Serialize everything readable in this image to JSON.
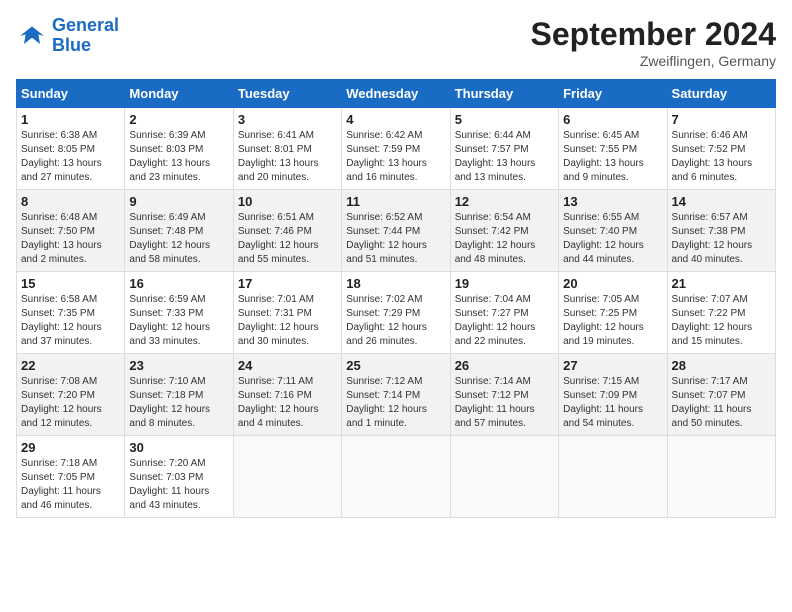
{
  "header": {
    "logo_general": "General",
    "logo_blue": "Blue",
    "month_title": "September 2024",
    "location": "Zweiflingen, Germany"
  },
  "calendar": {
    "weekdays": [
      "Sunday",
      "Monday",
      "Tuesday",
      "Wednesday",
      "Thursday",
      "Friday",
      "Saturday"
    ],
    "rows": [
      [
        {
          "day": "1",
          "info": "Sunrise: 6:38 AM\nSunset: 8:05 PM\nDaylight: 13 hours\nand 27 minutes."
        },
        {
          "day": "2",
          "info": "Sunrise: 6:39 AM\nSunset: 8:03 PM\nDaylight: 13 hours\nand 23 minutes."
        },
        {
          "day": "3",
          "info": "Sunrise: 6:41 AM\nSunset: 8:01 PM\nDaylight: 13 hours\nand 20 minutes."
        },
        {
          "day": "4",
          "info": "Sunrise: 6:42 AM\nSunset: 7:59 PM\nDaylight: 13 hours\nand 16 minutes."
        },
        {
          "day": "5",
          "info": "Sunrise: 6:44 AM\nSunset: 7:57 PM\nDaylight: 13 hours\nand 13 minutes."
        },
        {
          "day": "6",
          "info": "Sunrise: 6:45 AM\nSunset: 7:55 PM\nDaylight: 13 hours\nand 9 minutes."
        },
        {
          "day": "7",
          "info": "Sunrise: 6:46 AM\nSunset: 7:52 PM\nDaylight: 13 hours\nand 6 minutes."
        }
      ],
      [
        {
          "day": "8",
          "info": "Sunrise: 6:48 AM\nSunset: 7:50 PM\nDaylight: 13 hours\nand 2 minutes."
        },
        {
          "day": "9",
          "info": "Sunrise: 6:49 AM\nSunset: 7:48 PM\nDaylight: 12 hours\nand 58 minutes."
        },
        {
          "day": "10",
          "info": "Sunrise: 6:51 AM\nSunset: 7:46 PM\nDaylight: 12 hours\nand 55 minutes."
        },
        {
          "day": "11",
          "info": "Sunrise: 6:52 AM\nSunset: 7:44 PM\nDaylight: 12 hours\nand 51 minutes."
        },
        {
          "day": "12",
          "info": "Sunrise: 6:54 AM\nSunset: 7:42 PM\nDaylight: 12 hours\nand 48 minutes."
        },
        {
          "day": "13",
          "info": "Sunrise: 6:55 AM\nSunset: 7:40 PM\nDaylight: 12 hours\nand 44 minutes."
        },
        {
          "day": "14",
          "info": "Sunrise: 6:57 AM\nSunset: 7:38 PM\nDaylight: 12 hours\nand 40 minutes."
        }
      ],
      [
        {
          "day": "15",
          "info": "Sunrise: 6:58 AM\nSunset: 7:35 PM\nDaylight: 12 hours\nand 37 minutes."
        },
        {
          "day": "16",
          "info": "Sunrise: 6:59 AM\nSunset: 7:33 PM\nDaylight: 12 hours\nand 33 minutes."
        },
        {
          "day": "17",
          "info": "Sunrise: 7:01 AM\nSunset: 7:31 PM\nDaylight: 12 hours\nand 30 minutes."
        },
        {
          "day": "18",
          "info": "Sunrise: 7:02 AM\nSunset: 7:29 PM\nDaylight: 12 hours\nand 26 minutes."
        },
        {
          "day": "19",
          "info": "Sunrise: 7:04 AM\nSunset: 7:27 PM\nDaylight: 12 hours\nand 22 minutes."
        },
        {
          "day": "20",
          "info": "Sunrise: 7:05 AM\nSunset: 7:25 PM\nDaylight: 12 hours\nand 19 minutes."
        },
        {
          "day": "21",
          "info": "Sunrise: 7:07 AM\nSunset: 7:22 PM\nDaylight: 12 hours\nand 15 minutes."
        }
      ],
      [
        {
          "day": "22",
          "info": "Sunrise: 7:08 AM\nSunset: 7:20 PM\nDaylight: 12 hours\nand 12 minutes."
        },
        {
          "day": "23",
          "info": "Sunrise: 7:10 AM\nSunset: 7:18 PM\nDaylight: 12 hours\nand 8 minutes."
        },
        {
          "day": "24",
          "info": "Sunrise: 7:11 AM\nSunset: 7:16 PM\nDaylight: 12 hours\nand 4 minutes."
        },
        {
          "day": "25",
          "info": "Sunrise: 7:12 AM\nSunset: 7:14 PM\nDaylight: 12 hours\nand 1 minute."
        },
        {
          "day": "26",
          "info": "Sunrise: 7:14 AM\nSunset: 7:12 PM\nDaylight: 11 hours\nand 57 minutes."
        },
        {
          "day": "27",
          "info": "Sunrise: 7:15 AM\nSunset: 7:09 PM\nDaylight: 11 hours\nand 54 minutes."
        },
        {
          "day": "28",
          "info": "Sunrise: 7:17 AM\nSunset: 7:07 PM\nDaylight: 11 hours\nand 50 minutes."
        }
      ],
      [
        {
          "day": "29",
          "info": "Sunrise: 7:18 AM\nSunset: 7:05 PM\nDaylight: 11 hours\nand 46 minutes."
        },
        {
          "day": "30",
          "info": "Sunrise: 7:20 AM\nSunset: 7:03 PM\nDaylight: 11 hours\nand 43 minutes."
        },
        {
          "day": "",
          "info": ""
        },
        {
          "day": "",
          "info": ""
        },
        {
          "day": "",
          "info": ""
        },
        {
          "day": "",
          "info": ""
        },
        {
          "day": "",
          "info": ""
        }
      ]
    ]
  }
}
